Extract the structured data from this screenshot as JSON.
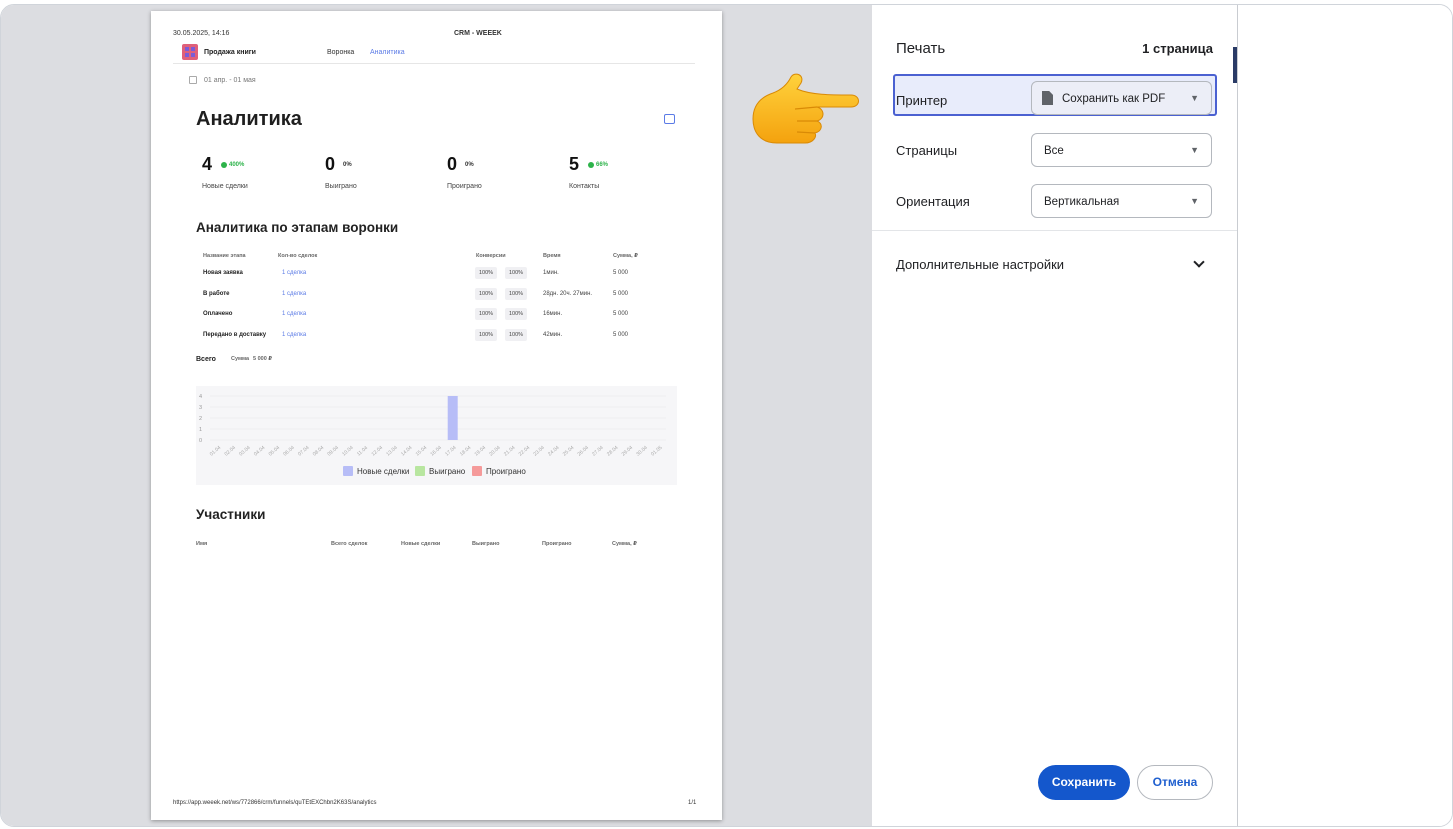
{
  "sheet": {
    "header_datetime": "30.05.2025, 14:16",
    "header_title": "CRM - WEEEK",
    "project_name": "Продажа книги",
    "nav_funnel": "Воронка",
    "nav_analytics": "Аналитика",
    "date_range": "01 апр. - 01 мая",
    "page_heading": "Аналитика",
    "kpis": [
      {
        "value": "4",
        "change": "400%",
        "label": "Новые сделки",
        "trend": "up"
      },
      {
        "value": "0",
        "change": "0%",
        "label": "Выиграно",
        "trend": "flat"
      },
      {
        "value": "0",
        "change": "0%",
        "label": "Проиграно",
        "trend": "flat"
      },
      {
        "value": "5",
        "change": "66%",
        "label": "Контакты",
        "trend": "up"
      }
    ],
    "funnel_heading": "Аналитика по этапам воронки",
    "funnel_columns": {
      "stage": "Название этапа",
      "count": "Кол-во сделок",
      "conversion": "Конверсии",
      "time": "Время",
      "sum": "Сумма, ₽"
    },
    "funnel_rows": [
      {
        "stage": "Новая заявка",
        "count": "1 сделка",
        "conv1": "100%",
        "conv2": "100%",
        "time": "1мин.",
        "sum": "5 000"
      },
      {
        "stage": "В работе",
        "count": "1 сделка",
        "conv1": "100%",
        "conv2": "100%",
        "time": "28дн. 20ч. 27мин.",
        "sum": "5 000"
      },
      {
        "stage": "Оплачено",
        "count": "1 сделка",
        "conv1": "100%",
        "conv2": "100%",
        "time": "16мин.",
        "sum": "5 000"
      },
      {
        "stage": "Передано в доставку",
        "count": "1 сделка",
        "conv1": "100%",
        "conv2": "100%",
        "time": "42мин.",
        "sum": "5 000"
      }
    ],
    "total_label": "Всего",
    "total_sum_label": "Сумма",
    "total_sum_value": "5 000 ₽",
    "participants_heading": "Участники",
    "participants_columns": [
      "Имя",
      "Всего сделок",
      "Новые сделки",
      "Выиграно",
      "Проиграно",
      "Сумма, ₽"
    ],
    "footer_url": "https://app.weeek.net/ws/772866/crm/funnels/quTEtEXChbn2K63S/analytics",
    "footer_page": "1/1"
  },
  "chart_data": {
    "type": "bar",
    "categories": [
      "01.04",
      "02.04",
      "03.04",
      "04.04",
      "05.04",
      "06.04",
      "07.04",
      "08.04",
      "09.04",
      "10.04",
      "11.04",
      "12.04",
      "13.04",
      "14.04",
      "15.04",
      "16.04",
      "17.04",
      "18.04",
      "19.04",
      "20.04",
      "21.04",
      "22.04",
      "23.04",
      "24.04",
      "25.04",
      "26.04",
      "27.04",
      "28.04",
      "29.04",
      "30.04",
      "01.05"
    ],
    "series": [
      {
        "name": "Новые сделки",
        "color": "#b7bdf7",
        "values": [
          0,
          0,
          0,
          0,
          0,
          0,
          0,
          0,
          0,
          0,
          0,
          0,
          0,
          0,
          0,
          0,
          4,
          0,
          0,
          0,
          0,
          0,
          0,
          0,
          0,
          0,
          0,
          0,
          0,
          0,
          0
        ]
      },
      {
        "name": "Выиграно",
        "color": "#b8e6a0",
        "values": [
          0,
          0,
          0,
          0,
          0,
          0,
          0,
          0,
          0,
          0,
          0,
          0,
          0,
          0,
          0,
          0,
          0,
          0,
          0,
          0,
          0,
          0,
          0,
          0,
          0,
          0,
          0,
          0,
          0,
          0,
          0
        ]
      },
      {
        "name": "Проиграно",
        "color": "#f59a9a",
        "values": [
          0,
          0,
          0,
          0,
          0,
          0,
          0,
          0,
          0,
          0,
          0,
          0,
          0,
          0,
          0,
          0,
          0,
          0,
          0,
          0,
          0,
          0,
          0,
          0,
          0,
          0,
          0,
          0,
          0,
          0,
          0
        ]
      }
    ],
    "y_ticks": [
      "0",
      "1",
      "2",
      "3",
      "4"
    ],
    "ylim": [
      0,
      4
    ],
    "legend_position": "bottom"
  },
  "settings": {
    "title": "Печать",
    "pages_count": "1 страница",
    "printer_label": "Принтер",
    "printer_value": "Сохранить как PDF",
    "pages_label": "Страницы",
    "pages_value": "Все",
    "orientation_label": "Ориентация",
    "orientation_value": "Вертикальная",
    "more_settings": "Дополнительные настройки",
    "save_button": "Сохранить",
    "cancel_button": "Отмена"
  },
  "accent_colors": {
    "primary_blue": "#1457cc",
    "highlight_border": "#4b61d1",
    "positive_green": "#2db34a"
  }
}
